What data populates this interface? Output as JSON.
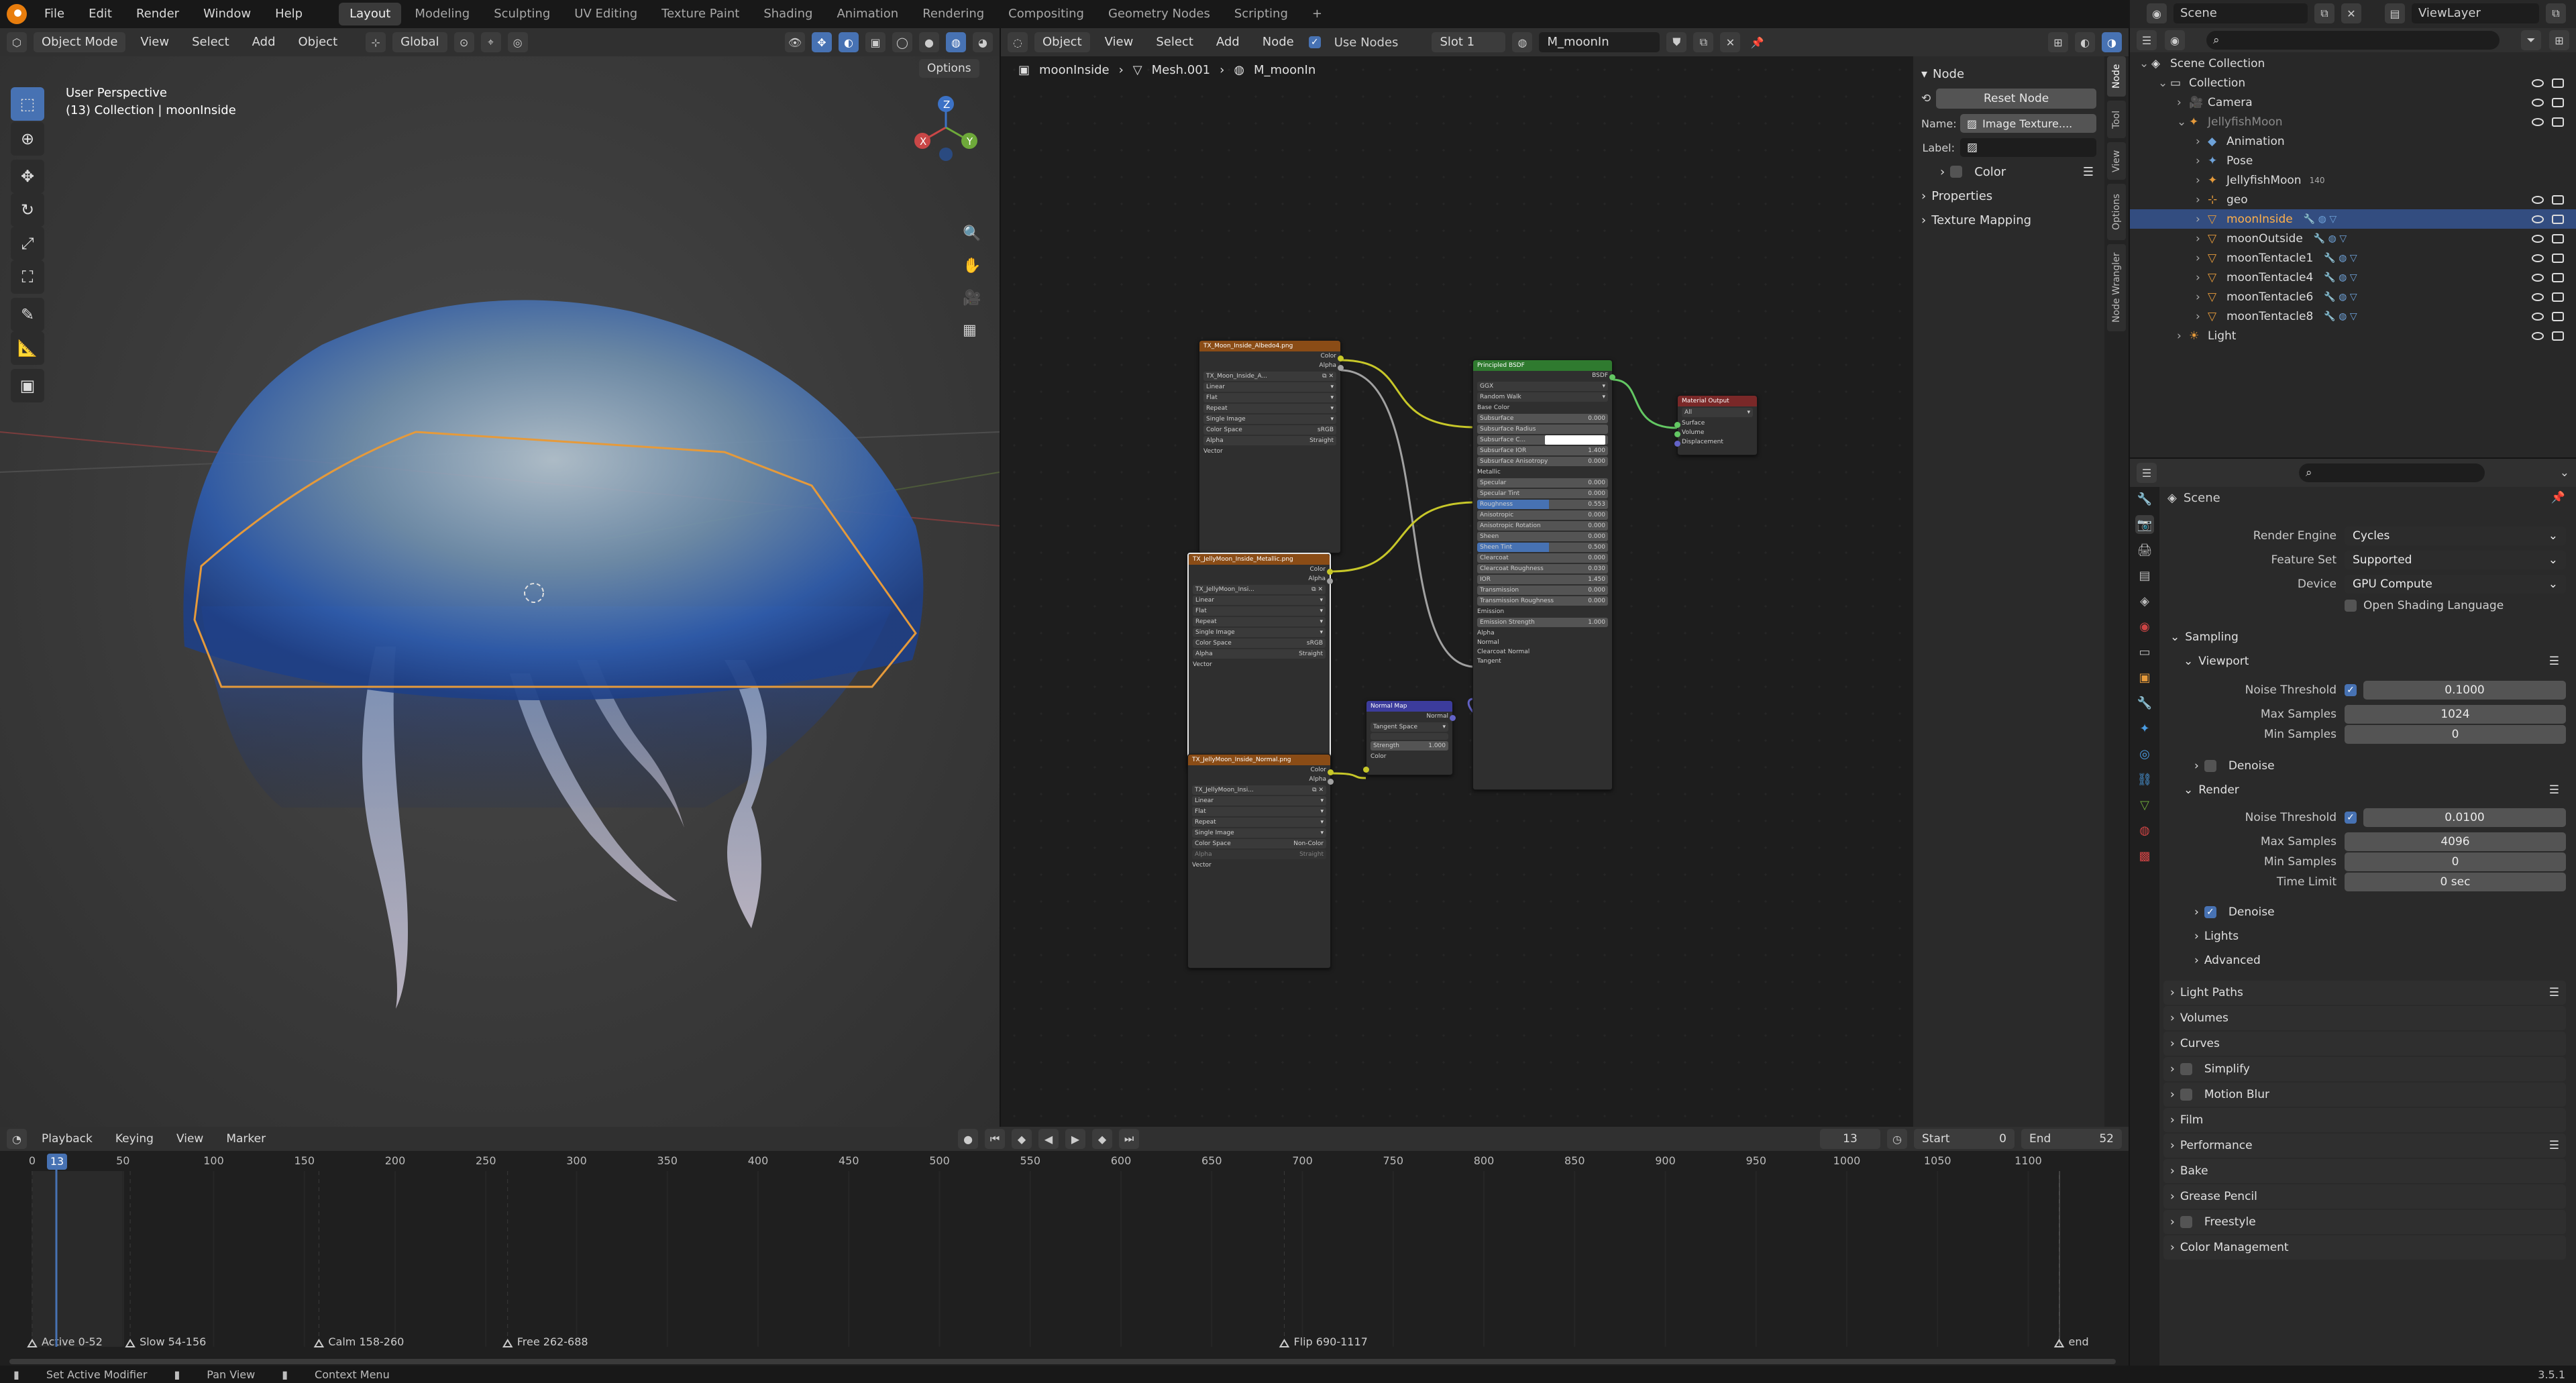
{
  "topbar": {
    "menus": [
      "File",
      "Edit",
      "Render",
      "Window",
      "Help"
    ],
    "workspaces": [
      "Layout",
      "Modeling",
      "Sculpting",
      "UV Editing",
      "Texture Paint",
      "Shading",
      "Animation",
      "Rendering",
      "Compositing",
      "Geometry Nodes",
      "Scripting"
    ],
    "active_workspace": "Layout",
    "add_tab": "+",
    "scene_name": "Scene",
    "viewlayer_name": "ViewLayer"
  },
  "viewport": {
    "mode": "Object Mode",
    "menus": [
      "View",
      "Select",
      "Add",
      "Object"
    ],
    "orientation": "Global",
    "options": "Options",
    "overlay_title": "User Perspective",
    "overlay_sub": "(13) Collection | moonInside",
    "gizmo": {
      "x": "X",
      "y": "Y",
      "z": "Z"
    }
  },
  "node_editor": {
    "editor_type": "Object",
    "menus": [
      "View",
      "Select",
      "Add",
      "Node"
    ],
    "use_nodes_label": "Use Nodes",
    "slot": "Slot 1",
    "material": "M_moonIn",
    "breadcrumb": [
      "moonInside",
      "Mesh.001",
      "M_moonIn"
    ],
    "nodes": {
      "albedo": {
        "title": "TX_Moon_Inside_Albedo4.png",
        "image": "TX_Moon_Inside_A...",
        "outputs": [
          "Color",
          "Alpha"
        ],
        "rows": [
          "Linear",
          "Flat",
          "Repeat",
          "Single Image"
        ],
        "colorspace_label": "Color Space",
        "colorspace": "sRGB",
        "alpha_label": "Alpha",
        "alpha": "Straight",
        "vector": "Vector"
      },
      "metallic": {
        "title": "TX_JellyMoon_Inside_Metallic.png",
        "image": "TX_JellyMoon_Insi...",
        "outputs": [
          "Color",
          "Alpha"
        ],
        "rows": [
          "Linear",
          "Flat",
          "Repeat",
          "Single Image"
        ],
        "colorspace_label": "Color Space",
        "colorspace": "sRGB",
        "alpha_label": "Alpha",
        "alpha": "Straight",
        "vector": "Vector"
      },
      "normal_tex": {
        "title": "TX_JellyMoon_Inside_Normal.png",
        "image": "TX_JellyMoon_Insi...",
        "outputs": [
          "Color",
          "Alpha"
        ],
        "rows": [
          "Linear",
          "Flat",
          "Repeat",
          "Single Image"
        ],
        "colorspace_label": "Color Space",
        "colorspace": "Non-Color",
        "alpha_label": "Alpha",
        "alpha": "Straight",
        "vector": "Vector"
      },
      "normalmap": {
        "title": "Normal Map",
        "output": "Normal",
        "space": "Tangent Space",
        "strength_label": "Strength",
        "strength": "1.000",
        "color": "Color"
      },
      "bsdf": {
        "title": "Principled BSDF",
        "output": "BSDF",
        "dist": "GGX",
        "sss": "Random Walk",
        "inputs": [
          [
            "Base Color",
            ""
          ],
          [
            "Subsurface",
            "0.000"
          ],
          [
            "Subsurface Radius",
            ""
          ],
          [
            "Subsurface C...",
            ""
          ],
          [
            "Subsurface IOR",
            "1.400"
          ],
          [
            "Subsurface Anisotropy",
            "0.000"
          ],
          [
            "Metallic",
            ""
          ],
          [
            "Specular",
            "0.000"
          ],
          [
            "Specular Tint",
            "0.000"
          ],
          [
            "Roughness",
            "0.553"
          ],
          [
            "Anisotropic",
            "0.000"
          ],
          [
            "Anisotropic Rotation",
            "0.000"
          ],
          [
            "Sheen",
            "0.000"
          ],
          [
            "Sheen Tint",
            "0.500"
          ],
          [
            "Clearcoat",
            "0.000"
          ],
          [
            "Clearcoat Roughness",
            "0.030"
          ],
          [
            "IOR",
            "1.450"
          ],
          [
            "Transmission",
            "0.000"
          ],
          [
            "Transmission Roughness",
            "0.000"
          ],
          [
            "Emission",
            ""
          ],
          [
            "Emission Strength",
            "1.000"
          ],
          [
            "Alpha",
            ""
          ],
          [
            "Normal",
            ""
          ],
          [
            "Clearcoat Normal",
            ""
          ],
          [
            "Tangent",
            ""
          ]
        ]
      },
      "output": {
        "title": "Material Output",
        "target": "All",
        "inputs": [
          "Surface",
          "Volume",
          "Displacement"
        ]
      }
    }
  },
  "npanel": {
    "tabs": [
      "Node",
      "Tool",
      "View",
      "Options",
      "Node Wrangler"
    ],
    "section": "Node",
    "reset": "Reset Node",
    "name_label": "Name:",
    "name_value": "Image Texture....",
    "label_label": "Label:",
    "color": "Color",
    "properties": "Properties",
    "texture_mapping": "Texture Mapping"
  },
  "outliner": {
    "items": [
      {
        "label": "Scene Collection",
        "level": 0,
        "kind": "scene"
      },
      {
        "label": "Collection",
        "level": 1,
        "kind": "collection"
      },
      {
        "label": "Camera",
        "level": 2,
        "kind": "camera"
      },
      {
        "label": "JellyfishMoon",
        "level": 2,
        "kind": "armature",
        "dim": true
      },
      {
        "label": "Animation",
        "level": 3,
        "kind": "anim"
      },
      {
        "label": "Pose",
        "level": 3,
        "kind": "pose"
      },
      {
        "label": "JellyfishMoon",
        "level": 3,
        "kind": "armature",
        "badge": "140"
      },
      {
        "label": "geo",
        "level": 3,
        "kind": "empty"
      },
      {
        "label": "moonInside",
        "level": 3,
        "kind": "mesh",
        "selected": true
      },
      {
        "label": "moonOutside",
        "level": 3,
        "kind": "mesh"
      },
      {
        "label": "moonTentacle1",
        "level": 3,
        "kind": "mesh"
      },
      {
        "label": "moonTentacle4",
        "level": 3,
        "kind": "mesh"
      },
      {
        "label": "moonTentacle6",
        "level": 3,
        "kind": "mesh"
      },
      {
        "label": "moonTentacle8",
        "level": 3,
        "kind": "mesh"
      },
      {
        "label": "Light",
        "level": 2,
        "kind": "light"
      }
    ]
  },
  "properties": {
    "title": "Scene",
    "render_engine_label": "Render Engine",
    "render_engine": "Cycles",
    "feature_set_label": "Feature Set",
    "feature_set": "Supported",
    "device_label": "Device",
    "device": "GPU Compute",
    "osl": "Open Shading Language",
    "sampling": "Sampling",
    "viewport": "Viewport",
    "vp_noise_label": "Noise Threshold",
    "vp_noise": "0.1000",
    "vp_max_label": "Max Samples",
    "vp_max": "1024",
    "vp_min_label": "Min Samples",
    "vp_min": "0",
    "vp_denoise": "Denoise",
    "render": "Render",
    "r_noise_label": "Noise Threshold",
    "r_noise": "0.0100",
    "r_max_label": "Max Samples",
    "r_max": "4096",
    "r_min_label": "Min Samples",
    "r_min": "0",
    "r_time_label": "Time Limit",
    "r_time": "0 sec",
    "r_denoise": "Denoise",
    "lights": "Lights",
    "advanced": "Advanced",
    "sections": [
      "Light Paths",
      "Volumes",
      "Curves",
      "Simplify",
      "Motion Blur",
      "Film",
      "Performance",
      "Bake",
      "Grease Pencil",
      "Freestyle",
      "Color Management"
    ]
  },
  "timeline": {
    "menus": [
      "Playback",
      "Keying",
      "View",
      "Marker"
    ],
    "current_frame": "13",
    "start_label": "Start",
    "start": "0",
    "end_label": "End",
    "end": "52",
    "ruler": [
      "0",
      "50",
      "100",
      "150",
      "200",
      "250",
      "300",
      "350",
      "400",
      "450",
      "500",
      "550",
      "600",
      "650",
      "700",
      "750",
      "800",
      "850",
      "900",
      "950",
      "1000",
      "1050",
      "1100"
    ],
    "markers": [
      "Active 0-52",
      "Slow 54-156",
      "Calm 158-260",
      "Free 262-688",
      "Flip 690-1117",
      "end"
    ]
  },
  "statusbar": {
    "items": [
      "Set Active Modifier",
      "Pan View",
      "Context Menu"
    ],
    "version": "3.5.1"
  },
  "colors": {
    "accent": "#4772b3",
    "texture_header": "#8a4c16",
    "shader_header": "#2f7a2f",
    "vector_header": "#3c3c9c",
    "output_header": "#7a2828",
    "selection": "#334d80",
    "active_object": "#e59a3b"
  }
}
